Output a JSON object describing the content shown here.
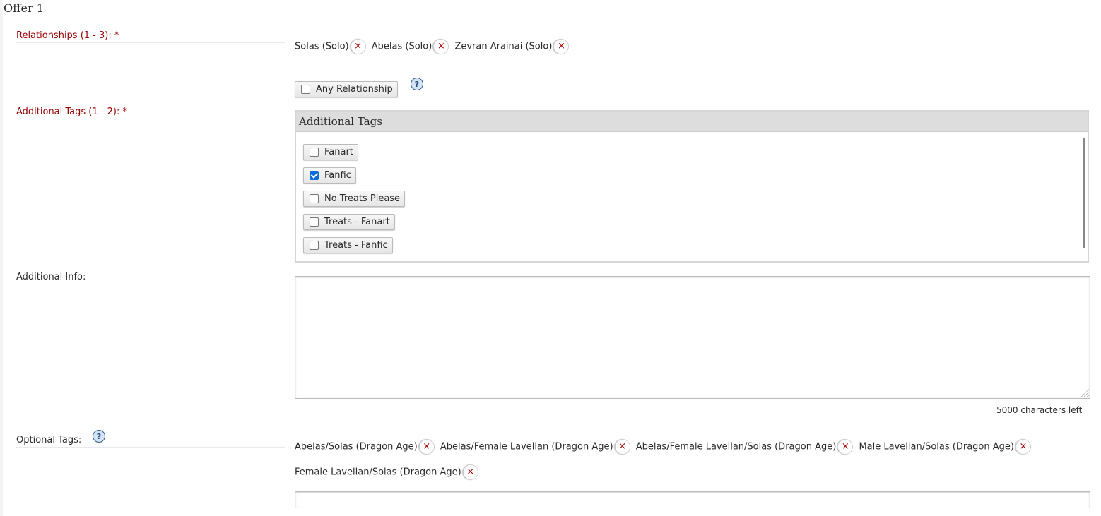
{
  "title": "Offer 1",
  "relationships": {
    "label": "Relationships (1 - 3): *",
    "tags": [
      {
        "text": "Solas (Solo)",
        "remove": "×"
      },
      {
        "text": "Abelas (Solo)",
        "remove": "×"
      },
      {
        "text": "Zevran Arainai (Solo)",
        "remove": "×"
      }
    ],
    "any_relationship": {
      "label": "Any Relationship",
      "checked": false
    },
    "help": "?"
  },
  "additional_tags": {
    "label": "Additional Tags (1 - 2): *",
    "box_title": "Additional Tags",
    "options": [
      {
        "label": "Fanart",
        "checked": false
      },
      {
        "label": "Fanfic",
        "checked": true
      },
      {
        "label": "No Treats Please",
        "checked": false
      },
      {
        "label": "Treats - Fanart",
        "checked": false
      },
      {
        "label": "Treats - Fanfic",
        "checked": false
      }
    ]
  },
  "additional_info": {
    "label": "Additional Info:",
    "value": "",
    "chars_left": "5000 characters left"
  },
  "optional_tags": {
    "label": "Optional Tags:",
    "help": "?",
    "tags": [
      {
        "text": "Abelas/Solas (Dragon Age)",
        "remove": "×"
      },
      {
        "text": "Abelas/Female Lavellan (Dragon Age)",
        "remove": "×"
      },
      {
        "text": "Abelas/Female Lavellan/Solas (Dragon Age)",
        "remove": "×"
      },
      {
        "text": "Male Lavellan/Solas (Dragon Age)",
        "remove": "×"
      },
      {
        "text": "Female Lavellan/Solas (Dragon Age)",
        "remove": "×"
      }
    ],
    "input_value": ""
  },
  "colors": {
    "required_label": "#990000",
    "remove_x": "#a80000",
    "checkbox_checked": "#0b6cd8",
    "help_bg": "#d4e3f3"
  }
}
